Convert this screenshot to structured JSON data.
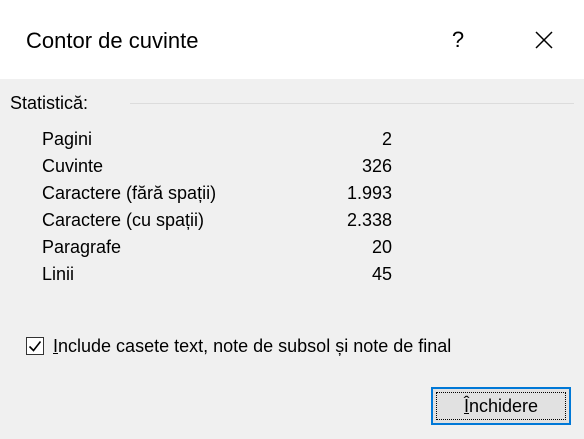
{
  "dialog": {
    "title": "Contor de cuvinte",
    "help_label": "?",
    "close_icon": "close-icon"
  },
  "stats_group": {
    "label": "Statistică:",
    "rows": [
      {
        "label": "Pagini",
        "value": "2"
      },
      {
        "label": "Cuvinte",
        "value": "326"
      },
      {
        "label": "Caractere (fără spații)",
        "value": "1.993"
      },
      {
        "label": "Caractere (cu spații)",
        "value": "2.338"
      },
      {
        "label": "Paragrafe",
        "value": "20"
      },
      {
        "label": "Linii",
        "value": "45"
      }
    ]
  },
  "include_option": {
    "checked": true,
    "mnemonic": "I",
    "label_rest": "nclude casete text, note de subsol și note de final"
  },
  "buttons": {
    "close_mnemonic": "Î",
    "close_rest": "nchidere"
  },
  "colors": {
    "accent": "#0078d7",
    "dialog_bg": "#f0f0f0",
    "titlebar_bg": "#ffffff",
    "button_bg": "#e1e1e1"
  }
}
